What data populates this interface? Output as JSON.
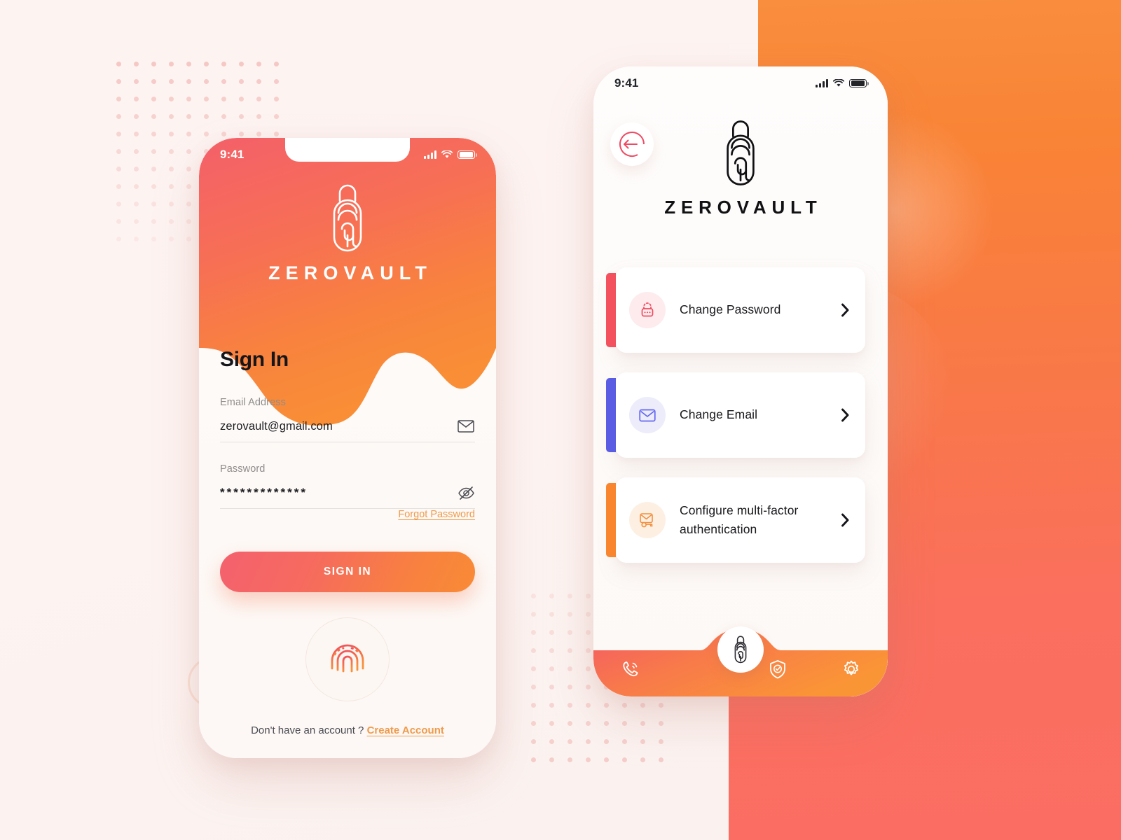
{
  "app": {
    "brand": "ZEROVAULT",
    "accent_red": "#f4606a",
    "accent_orange": "#f98b36",
    "accent_indigo": "#6366f1",
    "page_bg": "#fdf4f2"
  },
  "screen_signin": {
    "status_bar": {
      "time": "9:41",
      "signal_icon": "signal-bars-icon",
      "wifi_icon": "wifi-icon",
      "battery_icon": "battery-icon"
    },
    "brand": "ZEROVAULT",
    "logo_icon": "fingerprint-capsule-icon",
    "title": "Sign In",
    "email": {
      "label": "Email Address",
      "value": "zerovault@gmail.com",
      "placeholder": "Email Address",
      "icon": "envelope-icon"
    },
    "password": {
      "label": "Password",
      "value": "*************",
      "placeholder": "Password",
      "icon": "eye-off-icon"
    },
    "forgot_label": "Forgot Password",
    "submit_label": "SIGN IN",
    "biometric_icon": "fingerprint-scan-icon",
    "footer_text": "Don't have an account ?",
    "footer_link": "Create Account"
  },
  "screen_security": {
    "status_bar": {
      "time": "9:41",
      "signal_icon": "signal-bars-icon",
      "wifi_icon": "wifi-icon",
      "battery_icon": "battery-icon"
    },
    "back_icon": "arrow-left-icon",
    "brand": "ZEROVAULT",
    "logo_icon": "fingerprint-capsule-icon",
    "options": [
      {
        "label": "Change Password",
        "icon": "lock-icon",
        "accent": "#f4515f",
        "icon_bg": "#fdebee",
        "icon_color": "#ef4c5e",
        "chevron": "chevron-right-icon"
      },
      {
        "label": "Change Email",
        "icon": "envelope-icon",
        "accent": "#5b5ce4",
        "icon_bg": "#ececfb",
        "icon_color": "#6366f1",
        "chevron": "chevron-right-icon"
      },
      {
        "label": "Configure multi-factor authentication",
        "icon": "envelope-key-icon",
        "accent": "#f9852f",
        "icon_bg": "#fdf0e3",
        "icon_color": "#f18f3f",
        "chevron": "chevron-right-icon"
      }
    ],
    "nav": [
      {
        "name": "calls",
        "icon": "phone-ring-icon"
      },
      {
        "name": "biometric",
        "icon": "fingerprint-capsule-icon"
      },
      {
        "name": "security",
        "icon": "shield-check-icon"
      },
      {
        "name": "settings",
        "icon": "gear-icon"
      }
    ]
  }
}
